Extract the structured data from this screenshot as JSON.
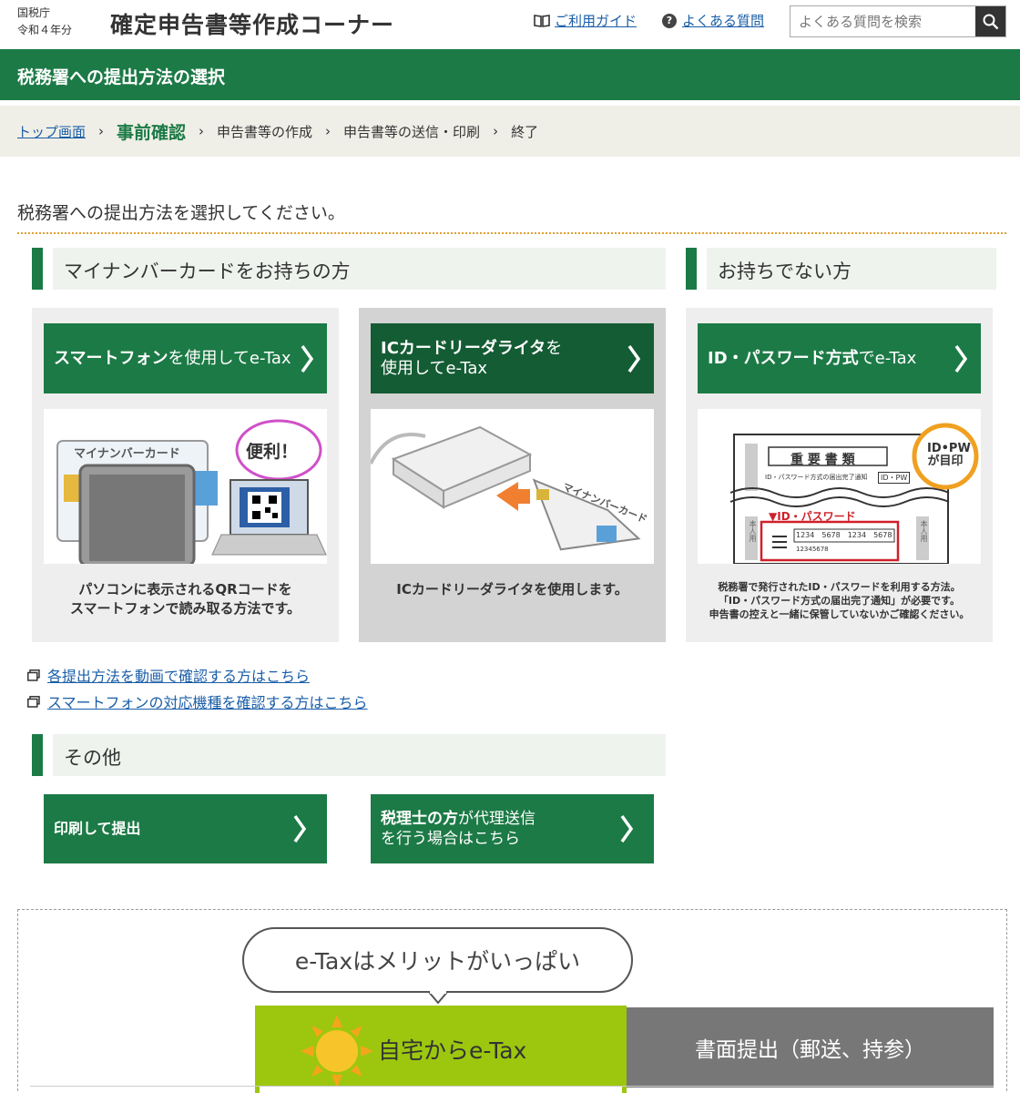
{
  "header": {
    "org_line1": "国税庁",
    "org_line2": "令和４年分",
    "title": "確定申告書等作成コーナー",
    "guide_label": "ご利用ガイド",
    "faq_label": "よくある質問",
    "search_placeholder": "よくある質問を検索"
  },
  "banner": {
    "title": "税務署への提出方法の選択"
  },
  "breadcrumb": [
    {
      "label": "トップ画面"
    },
    {
      "label": "事前確認"
    },
    {
      "label": "申告書等の作成"
    },
    {
      "label": "申告書等の送信・印刷"
    },
    {
      "label": "終了"
    }
  ],
  "instruction": "税務署への提出方法を選択してください。",
  "sections": {
    "mynumber": "マイナンバーカードをお持ちの方",
    "no_card": "お持ちでない方",
    "other": "その他"
  },
  "cards": [
    {
      "button_bold": "スマートフォン",
      "button_rest": "を使用してe-Tax",
      "caption_line1": "パソコンに表示されるQRコードを",
      "caption_line2": "スマートフォンで読み取る方法です。",
      "image_card_label": "マイナンバーカード",
      "image_bubble": "便利！"
    },
    {
      "button_bold": "ICカードリーダライタ",
      "button_rest": "を",
      "button_line2": "使用してe-Tax",
      "caption_line1": "ICカードリーダライタを使用します。",
      "image_card_label": "マイナンバーカード"
    },
    {
      "button_bold": "ID・パスワード方式",
      "button_rest": "でe-Tax",
      "caption_line1": "税務署で発行されたID・パスワードを利用する方法。",
      "caption_line2": "「ID・パスワード方式の届出完了通知」が必要です。",
      "caption_line3": "申告書の控えと一緒に保管していないかご確認ください。",
      "image_doc_title": "重 要 書 類",
      "image_doc_sub": "ID・パスワード方式の届出完了通知",
      "image_badge_line1": "ID•PW",
      "image_badge_line2": "が目印",
      "image_label": "▼ID・パスワード",
      "image_id_chip": "ID・PW",
      "image_side_label": "本人用",
      "image_digits": [
        "1234",
        "5678",
        "1234",
        "5678"
      ],
      "image_id_number": "12345678"
    }
  ],
  "links": [
    {
      "label": "各提出方法を動画で確認する方はこちら"
    },
    {
      "label": "スマートフォンの対応機種を確認する方はこちら"
    }
  ],
  "other_buttons": [
    {
      "label": "印刷して提出"
    },
    {
      "label_bold": "税理士の方",
      "label_rest": "が代理送信",
      "label_line2": "を行う場合はこちら"
    }
  ],
  "promo": {
    "bubble": "e-Taxはメリットがいっぱい",
    "etax_tab": "自宅からe-Tax",
    "paper_tab": "書面提出（郵送、持参）"
  },
  "colors": {
    "brand_green": "#1c7a46",
    "dark_green": "#145c34",
    "link_blue": "#1a5ea8",
    "lime": "#9cc70e",
    "gray_tab": "#777777"
  }
}
